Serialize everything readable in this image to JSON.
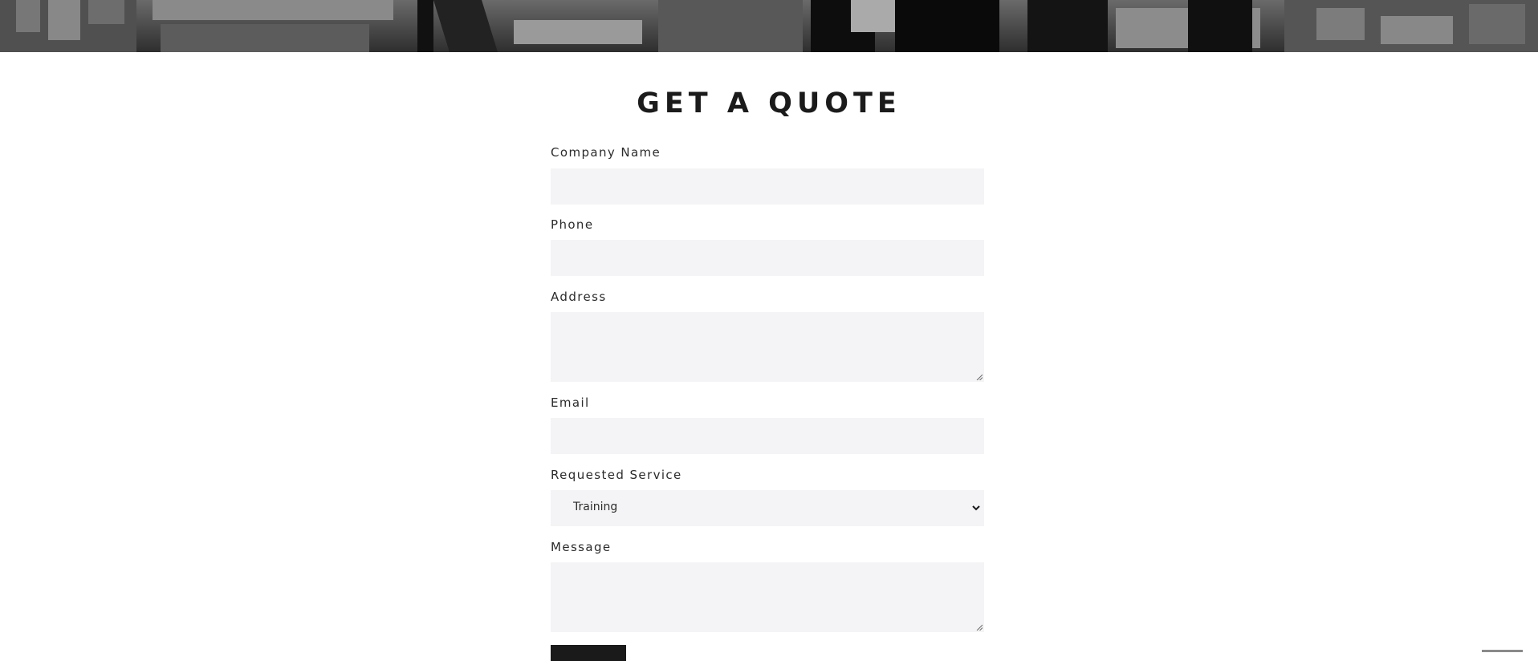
{
  "hero": {
    "alt": "city-skyline-photo"
  },
  "page": {
    "title": "GET A QUOTE"
  },
  "form": {
    "company_name": {
      "label": "Company Name",
      "value": ""
    },
    "phone": {
      "label": "Phone",
      "value": ""
    },
    "address": {
      "label": "Address",
      "value": ""
    },
    "email": {
      "label": "Email",
      "value": ""
    },
    "requested_service": {
      "label": "Requested Service",
      "selected": "Training"
    },
    "message": {
      "label": "Message",
      "value": ""
    },
    "submit_label": ""
  },
  "colors": {
    "field_bg": "#f4f4f6",
    "button_bg": "#1a1a1a",
    "text": "#1b1b1b"
  }
}
